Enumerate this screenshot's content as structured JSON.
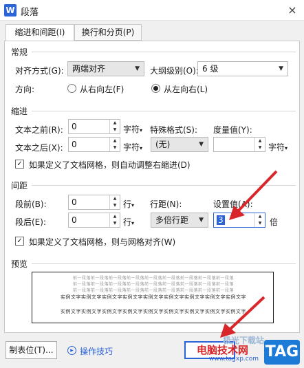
{
  "window": {
    "title": "段落",
    "app_icon": "W",
    "close": "×"
  },
  "tabs": [
    {
      "label": "缩进和间距(I)",
      "active": true
    },
    {
      "label": "换行和分页(P)",
      "active": false
    }
  ],
  "general": {
    "section": "常规",
    "alignment_label": "对齐方式(G):",
    "alignment_value": "两端对齐",
    "outline_label": "大纲级别(O):",
    "outline_value": "6 级",
    "direction_label": "方向:",
    "rtl_label": "从右向左(F)",
    "ltr_label": "从左向右(L)",
    "selected_direction": "ltr"
  },
  "indent": {
    "section": "缩进",
    "before_label": "文本之前(R):",
    "before_value": "0",
    "before_unit": "字符",
    "after_label": "文本之后(X):",
    "after_value": "0",
    "after_unit": "字符",
    "special_label": "特殊格式(S):",
    "special_value": "(无)",
    "measure_label": "度量值(Y):",
    "measure_value": "",
    "measure_unit": "字符",
    "grid_check_label": "如果定义了文档网格，则自动调整右缩进(D)",
    "grid_checked": true
  },
  "spacing": {
    "section": "间距",
    "before_label": "段前(B):",
    "before_value": "0",
    "before_unit": "行",
    "after_label": "段后(E):",
    "after_value": "0",
    "after_unit": "行",
    "line_label": "行距(N):",
    "line_value": "多倍行距",
    "setting_label": "设置值(A):",
    "setting_value": "3",
    "setting_unit": "倍",
    "grid_check_label": "如果定义了文档网格，则与网格对齐(W)",
    "grid_checked": true
  },
  "preview": {
    "section": "预览",
    "prev_text": "前一段落前一段落前一段落前一段落前一段落前一段落前一段落前一段落前一段落",
    "sample_text": "实例文字实例文字实例文字实例文字实例文字实例文字实例文字实例文字实例文字"
  },
  "footer": {
    "tabs_button": "制表位(T)...",
    "tips_label": "操作技巧",
    "watermark_site": "电脑技术网",
    "watermark_url": "www.tagxp.com",
    "watermark_tag": "TAG",
    "watermark_partial": "极光下载站"
  },
  "colors": {
    "accent": "#2b63d9",
    "arrow": "#d9262a",
    "tag_bg": "#1d7bd8"
  }
}
